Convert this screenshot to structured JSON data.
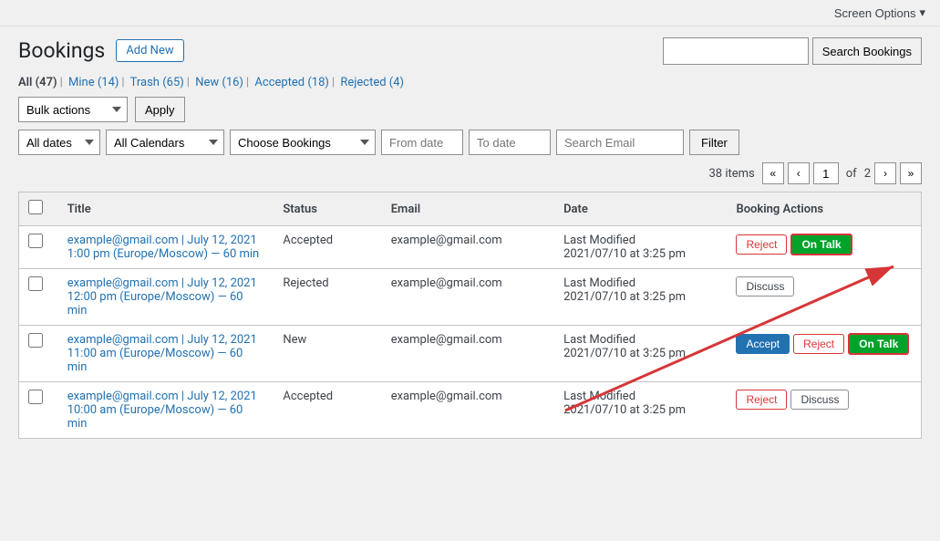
{
  "topbar": {
    "screen_options_label": "Screen Options",
    "chevron": "▾"
  },
  "header": {
    "title": "Bookings",
    "add_new_label": "Add New",
    "search_placeholder": "",
    "search_btn_label": "Search Bookings"
  },
  "nav": {
    "items": [
      {
        "label": "All",
        "count": "47",
        "active": true
      },
      {
        "label": "Mine",
        "count": "14"
      },
      {
        "label": "Trash",
        "count": "65"
      },
      {
        "label": "New",
        "count": "16"
      },
      {
        "label": "Accepted",
        "count": "18"
      },
      {
        "label": "Rejected",
        "count": "4"
      }
    ]
  },
  "toolbar": {
    "bulk_actions_label": "Bulk actions",
    "apply_label": "Apply"
  },
  "filters": {
    "dates_label": "All dates",
    "calendars_label": "All Calendars",
    "bookings_label": "Choose Bookings",
    "from_date_placeholder": "From date",
    "to_date_placeholder": "To date",
    "email_placeholder": "Search Email",
    "filter_label": "Filter"
  },
  "pagination": {
    "total_items": "38",
    "items_label": "items",
    "current_page": "1",
    "total_pages": "2",
    "of_label": "of",
    "first_label": "«",
    "prev_label": "‹",
    "next_label": "›",
    "last_label": "»"
  },
  "table": {
    "headers": {
      "title": "Title",
      "status": "Status",
      "email": "Email",
      "date": "Date",
      "actions": "Booking Actions"
    },
    "rows": [
      {
        "id": 1,
        "title": "example@gmail.com | July 12, 2021 1:00 pm (Europe/Moscow) — 60 min",
        "status": "Accepted",
        "email": "example@gmail.com",
        "date_label": "Last Modified",
        "date_value": "2021/07/10 at 3:25 pm",
        "actions": [
          "Reject",
          "On Talk"
        ]
      },
      {
        "id": 2,
        "title": "example@gmail.com | July 12, 2021 12:00 pm (Europe/Moscow) — 60 min",
        "status": "Rejected",
        "email": "example@gmail.com",
        "date_label": "Last Modified",
        "date_value": "2021/07/10 at 3:25 pm",
        "actions": [
          "Discuss"
        ]
      },
      {
        "id": 3,
        "title": "example@gmail.com | July 12, 2021 11:00 am (Europe/Moscow) — 60 min",
        "status": "New",
        "email": "example@gmail.com",
        "date_label": "Last Modified",
        "date_value": "2021/07/10 at 3:25 pm",
        "actions": [
          "Accept",
          "Reject",
          "On Talk"
        ]
      },
      {
        "id": 4,
        "title": "example@gmail.com | July 12, 2021 10:00 am (Europe/Moscow) — 60 min",
        "status": "Accepted",
        "email": "example@gmail.com",
        "date_label": "Last Modified",
        "date_value": "2021/07/10 at 3:25 pm",
        "actions": [
          "Reject",
          "Discuss"
        ]
      }
    ]
  }
}
